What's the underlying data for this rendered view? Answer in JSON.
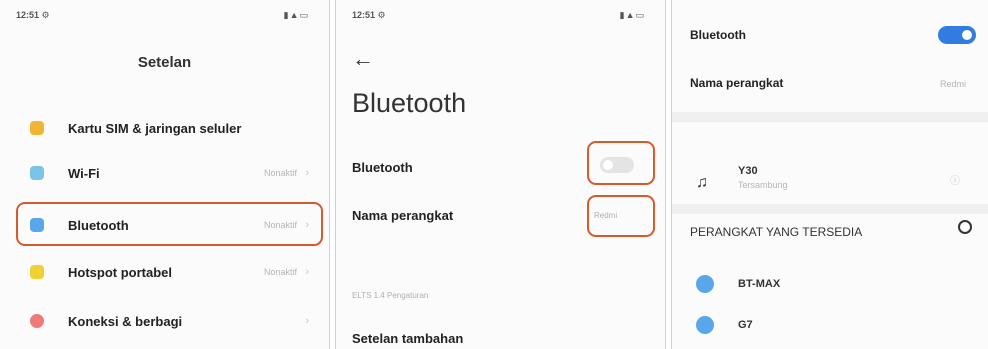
{
  "panel1": {
    "status_time": "12:51 ⚙",
    "status_icons": "▮▲▭",
    "title": "Setelan",
    "items": [
      {
        "label": "Kartu SIM & jaringan seluler",
        "value": "",
        "icon_color": "#f2b533"
      },
      {
        "label": "Wi-Fi",
        "value": "Nonaktif",
        "icon_color": "#7cc3ea"
      },
      {
        "label": "Bluetooth",
        "value": "Nonaktif",
        "icon_color": "#5aa6ea"
      },
      {
        "label": "Hotspot portabel",
        "value": "Nonaktif",
        "icon_color": "#f2cf33"
      },
      {
        "label": "Koneksi & berbagi",
        "value": "",
        "icon_color": "#ee7a7a"
      }
    ]
  },
  "panel2": {
    "status_time": "12:51 ⚙",
    "status_icons": "▮▲▭",
    "back": "←",
    "title": "Bluetooth",
    "bluetooth_label": "Bluetooth",
    "device_name_label": "Nama perangkat",
    "device_name_value": "Redmi",
    "section_label": "ELTS 1.4 Pengaturan",
    "extra_label": "Setelan tambahan"
  },
  "panel3": {
    "bluetooth_label": "Bluetooth",
    "device_name_label": "Nama perangkat",
    "device_name_value": "Redmi",
    "paired_name": "Y30",
    "paired_status": "Tersambung",
    "available_header": "PERANGKAT YANG TERSEDIA",
    "available": [
      "BT-MAX",
      "G7"
    ]
  },
  "colors": {
    "highlight": "#d9592e",
    "toggle_on": "#2f7de1"
  }
}
